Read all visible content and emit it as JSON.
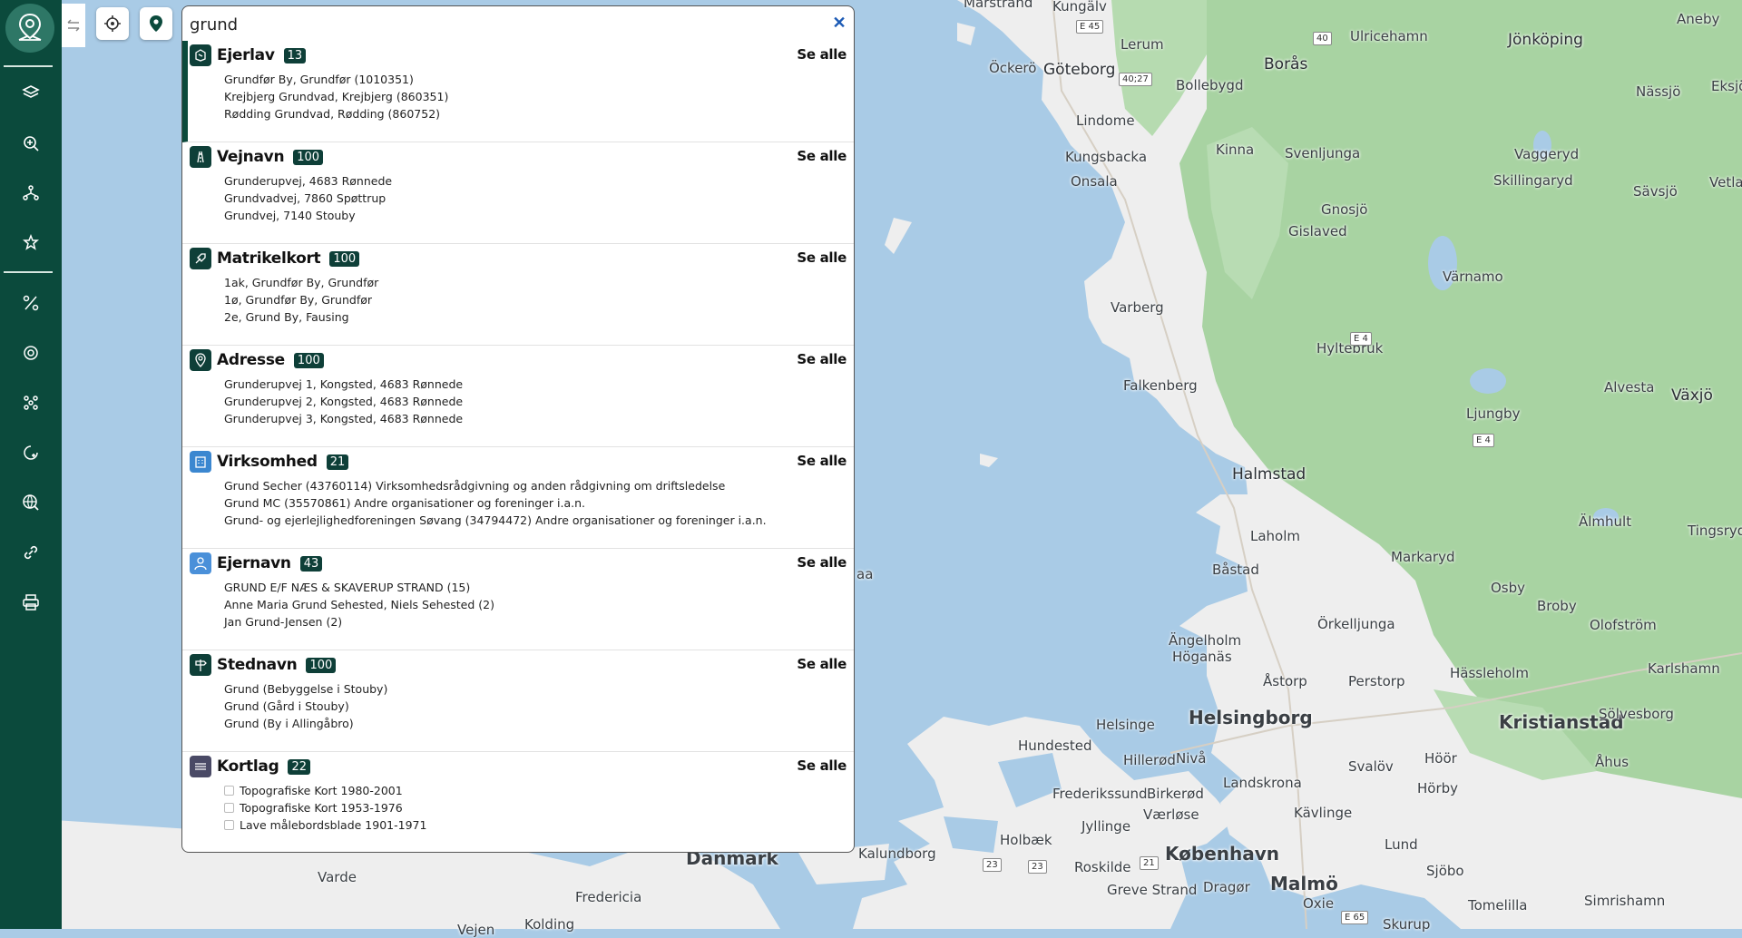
{
  "search": {
    "value": "grund",
    "clear_icon": "close-icon"
  },
  "colors": {
    "sidebar": "#0b4a3c",
    "badge": "#0e3f38",
    "water": "#a9cbe6",
    "land": "#eeeeee",
    "forest": "#a8d3a2"
  },
  "sidebar": {
    "logo_icon": "map-pin-logo-icon",
    "items": [
      {
        "icon": "layers-icon"
      },
      {
        "icon": "zoom-search-icon"
      },
      {
        "icon": "hierarchy-icon"
      },
      {
        "icon": "star-cursor-icon"
      },
      {
        "icon": "percent-tools-icon"
      },
      {
        "icon": "rotate-target-icon"
      },
      {
        "icon": "network-icon"
      },
      {
        "icon": "history-location-icon"
      },
      {
        "icon": "globe-search-icon"
      },
      {
        "icon": "link-icon"
      },
      {
        "icon": "print-icon"
      }
    ]
  },
  "toolbar": {
    "collapse_icon": "swap-arrows-icon",
    "locate_icon": "crosshair-icon",
    "marker_icon": "location-pin-icon"
  },
  "results": [
    {
      "title": "Ejerlav",
      "count": "13",
      "see_all": "Se alle",
      "icon": "ejerlav-icon",
      "items": [
        "Grundfør By, Grundfør (1010351)",
        "Krejbjerg Grundvad, Krejbjerg (860351)",
        "Rødding Grundvad, Rødding (860752)"
      ]
    },
    {
      "title": "Vejnavn",
      "count": "100",
      "see_all": "Se alle",
      "icon": "road-icon",
      "items": [
        "Grunderupvej, 4683 Rønnede",
        "Grundvadvej, 7860 Spøttrup",
        "Grundvej, 7140 Stouby"
      ]
    },
    {
      "title": "Matrikelkort",
      "count": "100",
      "see_all": "Se alle",
      "icon": "cadastral-icon",
      "items": [
        "1ak, Grundfør By, Grundfør",
        "1ø, Grundfør By, Grundfør",
        "2e, Grund By, Fausing"
      ]
    },
    {
      "title": "Adresse",
      "count": "100",
      "see_all": "Se alle",
      "icon": "address-pin-icon",
      "items": [
        "Grunderupvej 1, Kongsted, 4683 Rønnede",
        "Grunderupvej 2, Kongsted, 4683 Rønnede",
        "Grunderupvej 3, Kongsted, 4683 Rønnede"
      ]
    },
    {
      "title": "Virksomhed",
      "count": "21",
      "see_all": "Se alle",
      "icon": "company-icon",
      "items": [
        "Grund Secher (43760114) Virksomhedsrådgivning og anden rådgivning om driftsledelse",
        "Grund MC (35570861) Andre organisationer og foreninger i.a.n.",
        "Grund- og ejerlejlighedforeningen Søvang (34794472) Andre organisationer og foreninger i.a.n."
      ]
    },
    {
      "title": "Ejernavn",
      "count": "43",
      "see_all": "Se alle",
      "icon": "person-icon",
      "items": [
        "GRUND E/F NÆS & SKAVERUP STRAND (15)",
        "Anne Maria Grund Sehested, Niels Sehested (2)",
        "Jan Grund-Jensen (2)"
      ]
    },
    {
      "title": "Stednavn",
      "count": "100",
      "see_all": "Se alle",
      "icon": "signpost-icon",
      "items": [
        "Grund (Bebyggelse i Stouby)",
        "Grund (Gård i Stouby)",
        "Grund (By i Allingåbro)"
      ]
    },
    {
      "title": "Kortlag",
      "count": "22",
      "see_all": "Se alle",
      "icon": "map-layer-icon",
      "items": [
        "Topografiske Kort 1980-2001",
        "Topografiske Kort 1953-1976",
        "Lave målebordsblade 1901-1971"
      ]
    }
  ],
  "map": {
    "places": [
      "Marstrand",
      "Kungälv",
      "Lerum",
      "Ulricehamn",
      "Jönköping",
      "Aneby",
      "Öckerö",
      "Göteborg",
      "Borås",
      "Bollebygd",
      "Nässjö",
      "Eksjö",
      "Lindome",
      "Kungsbacka",
      "Kinna",
      "Svenljunga",
      "Vaggeryd",
      "Onsala",
      "Skillingaryd",
      "Vetlanda",
      "Sävsjö",
      "Gnosjö",
      "Gislaved",
      "Värnamo",
      "Varberg",
      "Hyltebruk",
      "Falkenberg",
      "Alvesta",
      "Växjö",
      "Ljungby",
      "Halmstad",
      "Älmhult",
      "Tingsryd",
      "Laholm",
      "Markaryd",
      "Båstad",
      "Osby",
      "Ängelholm",
      "Örkelljunga",
      "Broby",
      "Olofström",
      "Höganäs",
      "Åstorp",
      "Perstorp",
      "Hässleholm",
      "Karlshamn",
      "Helsinge",
      "Helsingborg",
      "Kristianstad",
      "Sölvesborg",
      "Hundested",
      "Hillerød",
      "Nivå",
      "Svalöv",
      "Höör",
      "Åhus",
      "Frederikssund",
      "Birkerød",
      "Landskrona",
      "Hörby",
      "Jyllinge",
      "Værløse",
      "Kävlinge",
      "Holbæk",
      "Lund",
      "Kalundborg",
      "Roskilde",
      "København",
      "Malmö",
      "Sjöbo",
      "Greve Strand",
      "Dragør",
      "Oxie",
      "Tomelilla",
      "Simrishamn",
      "Varde",
      "Danmark",
      "Fredericia",
      "Kolding",
      "Skurup",
      "Vejen",
      "aa"
    ],
    "roads": [
      "E 45",
      "40",
      "40;27",
      "E 4",
      "E 4",
      "21",
      "23",
      "23",
      "E 65"
    ]
  }
}
